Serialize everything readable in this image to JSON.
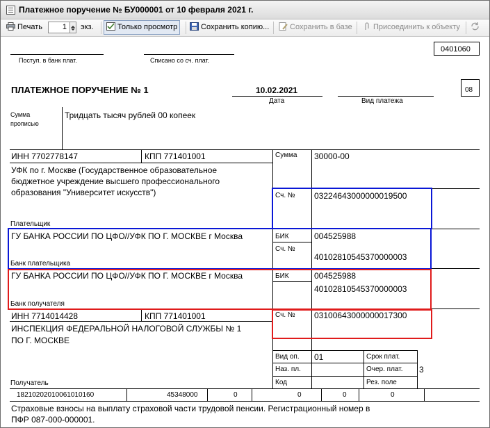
{
  "window": {
    "title": "Платежное поручение № БУ000001 от 10 февраля 2021 г."
  },
  "toolbar": {
    "print_label": "Печать",
    "copies_value": "1",
    "copies_unit": "экз.",
    "view_only_label": "Только просмотр",
    "save_copy_label": "Сохранить копию...",
    "save_db_label": "Сохранить в базе",
    "attach_label": "Присоединить к объекту"
  },
  "form": {
    "okud": "0401060",
    "received_label": "Поступ. в банк плат.",
    "debited_label": "Списано со сч. плат.",
    "heading": "ПЛАТЕЖНОЕ ПОРУЧЕНИЕ № 1",
    "date": "10.02.2021",
    "date_label": "Дата",
    "payment_type_label": "Вид платежа",
    "status_code": "08",
    "sum_words_label_1": "Сумма",
    "sum_words_label_2": "прописью",
    "sum_words": "Тридцать тысяч рублей 00 копеек",
    "payer_inn": "ИНН 7702778147",
    "payer_kpp": "КПП 771401001",
    "sum_label": "Сумма",
    "sum_value": "30000-00",
    "payer_name_1": "УФК по г. Москве (Государственное образовательное",
    "payer_name_2": "бюджетное учреждение высшего профессионального",
    "payer_name_3": "образования \"Университет искусств\")",
    "account_label": "Сч. №",
    "payer_account": "03224643000000019500",
    "payer_label": "Плательщик",
    "payer_bank": "ГУ БАНКА РОССИИ ПО ЦФО//УФК ПО Г. МОСКВЕ г Москва",
    "bik_label": "БИК",
    "payer_bik": "004525988",
    "payer_corr_account": "40102810545370000003",
    "payer_bank_label": "Банк плательщика",
    "payee_bank": "ГУ БАНКА РОССИИ ПО ЦФО//УФК ПО Г. МОСКВЕ г Москва",
    "payee_bik": "004525988",
    "payee_corr_account": "40102810545370000003",
    "payee_bank_label": "Банк получателя",
    "payee_inn": "ИНН 7714014428",
    "payee_kpp": "КПП 771401001",
    "payee_account": "03100643000000017300",
    "payee_name_1": "ИНСПЕКЦИЯ ФЕДЕРАЛЬНОЙ НАЛОГОВОЙ СЛУЖБЫ № 1",
    "payee_name_2": "ПО Г. МОСКВЕ",
    "op_type_label": "Вид оп.",
    "op_type_value": "01",
    "due_label": "Срок плат.",
    "purpose_label": "Наз. пл.",
    "order_label": "Очер. плат.",
    "order_value": "3",
    "code_label": "Код",
    "reserve_label": "Рез. поле",
    "payee_label": "Получатель",
    "kbk": "18210202010061010160",
    "oktmo": "45348000",
    "basis": "0",
    "period": "0",
    "doc_num": "0",
    "doc_date": "0",
    "purpose_1": "Страховые взносы на выплату страховой части трудовой пенсии. Регистрационный номер в",
    "purpose_2": "ПФР 087-000-000001."
  },
  "colors": {
    "highlight_blue": "#0a17d6",
    "highlight_red": "#e01b1b"
  },
  "icons": [
    "document-icon",
    "printer-icon",
    "view-only-icon",
    "save-copy-icon",
    "save-db-icon",
    "attach-icon",
    "refresh-icon"
  ]
}
